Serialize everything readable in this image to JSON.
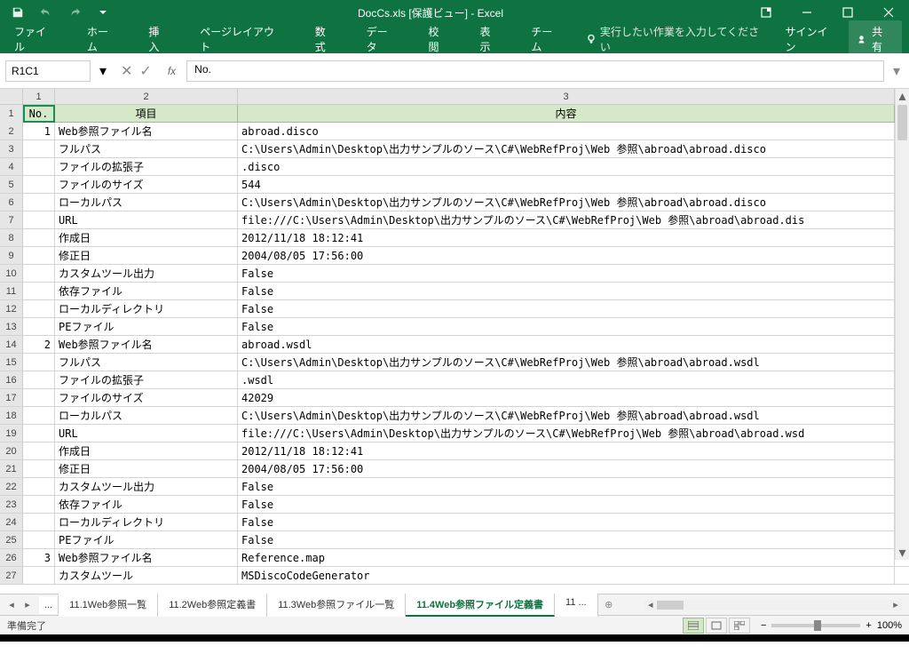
{
  "titlebar": {
    "title": "DocCs.xls [保護ビュー] - Excel"
  },
  "ribbon": {
    "tabs": [
      "ファイル",
      "ホーム",
      "挿入",
      "ページレイアウト",
      "数式",
      "データ",
      "校閲",
      "表示",
      "チーム"
    ],
    "tell_me": "実行したい作業を入力してください",
    "signin": "サインイン",
    "share": "共有"
  },
  "formula": {
    "name_box": "R1C1",
    "value": "No."
  },
  "cols": [
    "1",
    "2",
    "3"
  ],
  "header_row": {
    "c1": "No.",
    "c2": "項目",
    "c3": "内容"
  },
  "rows": [
    {
      "r": "2",
      "n": "1",
      "k": "Web参照ファイル名",
      "v": "abroad.disco"
    },
    {
      "r": "3",
      "n": "",
      "k": "フルパス",
      "v": "C:\\Users\\Admin\\Desktop\\出力サンプルのソース\\C#\\WebRefProj\\Web 参照\\abroad\\abroad.disco"
    },
    {
      "r": "4",
      "n": "",
      "k": "ファイルの拡張子",
      "v": ".disco"
    },
    {
      "r": "5",
      "n": "",
      "k": "ファイルのサイズ",
      "v": "544"
    },
    {
      "r": "6",
      "n": "",
      "k": "ローカルパス",
      "v": "C:\\Users\\Admin\\Desktop\\出力サンプルのソース\\C#\\WebRefProj\\Web 参照\\abroad\\abroad.disco"
    },
    {
      "r": "7",
      "n": "",
      "k": "URL",
      "v": "file:///C:\\Users\\Admin\\Desktop\\出力サンプルのソース\\C#\\WebRefProj\\Web 参照\\abroad\\abroad.dis"
    },
    {
      "r": "8",
      "n": "",
      "k": "作成日",
      "v": "2012/11/18 18:12:41"
    },
    {
      "r": "9",
      "n": "",
      "k": "修正日",
      "v": "2004/08/05 17:56:00"
    },
    {
      "r": "10",
      "n": "",
      "k": "カスタムツール出力",
      "v": "False"
    },
    {
      "r": "11",
      "n": "",
      "k": "依存ファイル",
      "v": "False"
    },
    {
      "r": "12",
      "n": "",
      "k": "ローカルディレクトリ",
      "v": "False"
    },
    {
      "r": "13",
      "n": "",
      "k": "PEファイル",
      "v": "False"
    },
    {
      "r": "14",
      "n": "2",
      "k": "Web参照ファイル名",
      "v": "abroad.wsdl"
    },
    {
      "r": "15",
      "n": "",
      "k": "フルパス",
      "v": "C:\\Users\\Admin\\Desktop\\出力サンプルのソース\\C#\\WebRefProj\\Web 参照\\abroad\\abroad.wsdl"
    },
    {
      "r": "16",
      "n": "",
      "k": "ファイルの拡張子",
      "v": ".wsdl"
    },
    {
      "r": "17",
      "n": "",
      "k": "ファイルのサイズ",
      "v": "42029"
    },
    {
      "r": "18",
      "n": "",
      "k": "ローカルパス",
      "v": "C:\\Users\\Admin\\Desktop\\出力サンプルのソース\\C#\\WebRefProj\\Web 参照\\abroad\\abroad.wsdl"
    },
    {
      "r": "19",
      "n": "",
      "k": "URL",
      "v": "file:///C:\\Users\\Admin\\Desktop\\出力サンプルのソース\\C#\\WebRefProj\\Web 参照\\abroad\\abroad.wsd"
    },
    {
      "r": "20",
      "n": "",
      "k": "作成日",
      "v": "2012/11/18 18:12:41"
    },
    {
      "r": "21",
      "n": "",
      "k": "修正日",
      "v": "2004/08/05 17:56:00"
    },
    {
      "r": "22",
      "n": "",
      "k": "カスタムツール出力",
      "v": "False"
    },
    {
      "r": "23",
      "n": "",
      "k": "依存ファイル",
      "v": "False"
    },
    {
      "r": "24",
      "n": "",
      "k": "ローカルディレクトリ",
      "v": "False"
    },
    {
      "r": "25",
      "n": "",
      "k": "PEファイル",
      "v": "False"
    },
    {
      "r": "26",
      "n": "3",
      "k": "Web参照ファイル名",
      "v": "Reference.map"
    },
    {
      "r": "27",
      "n": "",
      "k": "カスタムツール",
      "v": "MSDiscoCodeGenerator"
    }
  ],
  "sheets": {
    "ellipsis_left": "...",
    "tabs": [
      "11.1Web参照一覧",
      "11.2Web参照定義書",
      "11.3Web参照ファイル一覧",
      "11.4Web参照ファイル定義書",
      "11 ..."
    ],
    "active_index": 3
  },
  "status": {
    "text": "準備完了",
    "zoom": "100%"
  }
}
